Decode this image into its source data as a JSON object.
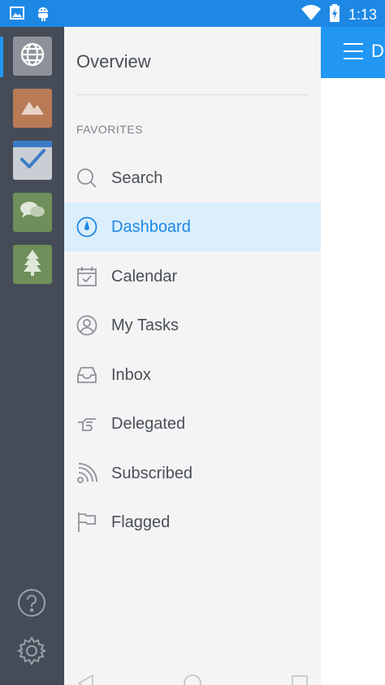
{
  "status_bar": {
    "time": "1:13",
    "icons": [
      "image-icon",
      "android-icon",
      "wifi-icon",
      "battery-charging-icon"
    ]
  },
  "background_app": {
    "title_peek": "D"
  },
  "rail": {
    "spaces": [
      {
        "name": "globe-space",
        "icon": "globe-icon",
        "color": "#8d929a",
        "active": true
      },
      {
        "name": "mountains-space",
        "icon": "mountains-icon",
        "color": "#b97a56"
      },
      {
        "name": "checkmark-space",
        "icon": "checkmark-icon",
        "color": "#8aa3bf"
      },
      {
        "name": "chat-space",
        "icon": "chat-bubbles-icon",
        "color": "#6f8f5a"
      },
      {
        "name": "tree-space",
        "icon": "tree-icon",
        "color": "#6f8f5a"
      }
    ],
    "bottom": [
      "help-icon",
      "gear-icon"
    ]
  },
  "drawer": {
    "title": "Overview",
    "section_label": "FAVORITES",
    "items": [
      {
        "label": "Search",
        "icon": "search-icon"
      },
      {
        "label": "Dashboard",
        "icon": "compass-icon",
        "active": true
      },
      {
        "label": "Calendar",
        "icon": "calendar-icon"
      },
      {
        "label": "My Tasks",
        "icon": "user-icon"
      },
      {
        "label": "Inbox",
        "icon": "inbox-icon"
      },
      {
        "label": "Delegated",
        "icon": "pointing-hand-icon"
      },
      {
        "label": "Subscribed",
        "icon": "rss-icon"
      },
      {
        "label": "Flagged",
        "icon": "flag-icon"
      }
    ]
  },
  "colors": {
    "accent": "#1e88e5",
    "rail": "#464c57",
    "drawer_bg": "#f4f4f5",
    "active_bg": "#dbeefc"
  }
}
